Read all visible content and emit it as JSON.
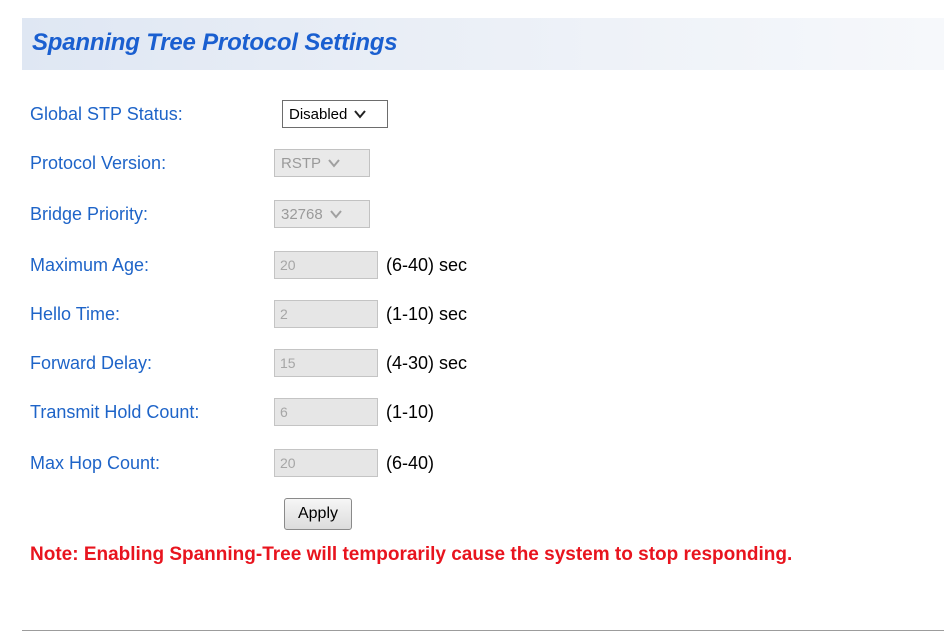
{
  "panel": {
    "title": "Spanning Tree Protocol Settings"
  },
  "fields": {
    "global_stp_status": {
      "label": "Global STP Status:",
      "value": "Disabled"
    },
    "protocol_version": {
      "label": "Protocol Version:",
      "value": "RSTP"
    },
    "bridge_priority": {
      "label": "Bridge Priority:",
      "value": "32768"
    },
    "maximum_age": {
      "label": "Maximum Age:",
      "value": "20",
      "range": "(6-40) sec"
    },
    "hello_time": {
      "label": "Hello Time:",
      "value": "2",
      "range": "(1-10) sec"
    },
    "forward_delay": {
      "label": "Forward Delay:",
      "value": "15",
      "range": "(4-30) sec"
    },
    "transmit_hold_count": {
      "label": "Transmit Hold Count:",
      "value": "6",
      "range": "(1-10)"
    },
    "max_hop_count": {
      "label": "Max Hop Count:",
      "value": "20",
      "range": "(6-40)"
    }
  },
  "actions": {
    "apply_label": "Apply"
  },
  "note": "Note: Enabling Spanning-Tree will temporarily cause the system to stop responding.",
  "colors": {
    "label": "#1e64c8",
    "title": "#1a5fd0",
    "note": "#e8141e"
  }
}
